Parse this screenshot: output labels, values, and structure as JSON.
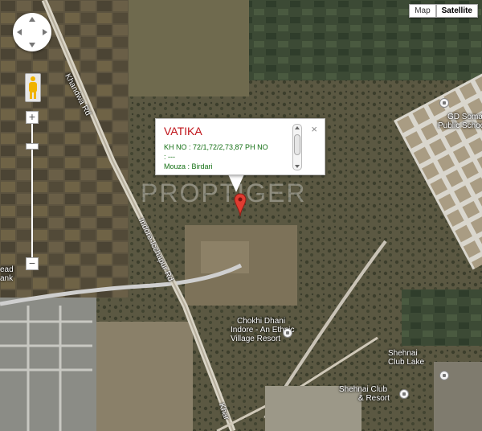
{
  "map_type": {
    "options": [
      "Map",
      "Satellite"
    ],
    "selected": "Satellite"
  },
  "controls": {
    "zoom_in": "+",
    "zoom_out": "−",
    "zoom_level_fraction": 0.15
  },
  "info_window": {
    "title": "VATIKA",
    "line1": "KH NO : 72/1,72/2,73,87 PH NO",
    "line2": ": ---",
    "line3": "Mouza : Birdari",
    "close": "×"
  },
  "watermark": "PROPTIGER",
  "map_labels": {
    "school_1": "GD Somani",
    "school_2": "Public School",
    "road_khandwa": "Khandwa Rd",
    "road_indore": "Indore-Icchapur Rd",
    "road_khar": "Khar",
    "tank_1": "ead",
    "tank_2": "ank",
    "chokhi_1": "Chokhi Dhani",
    "chokhi_2": "Indore - An Ethnic",
    "chokhi_3": "Village Resort",
    "lake_1": "Shehnai",
    "lake_2": "Club Lake",
    "club_1": "Shehnai Club",
    "club_2": "& Resort"
  },
  "icons": [
    "pan-control-icon",
    "pegman-icon",
    "map-marker-icon",
    "poi-icon"
  ],
  "colors": {
    "marker": "#e03c31",
    "title": "#c0141a",
    "info_text": "#147014"
  }
}
